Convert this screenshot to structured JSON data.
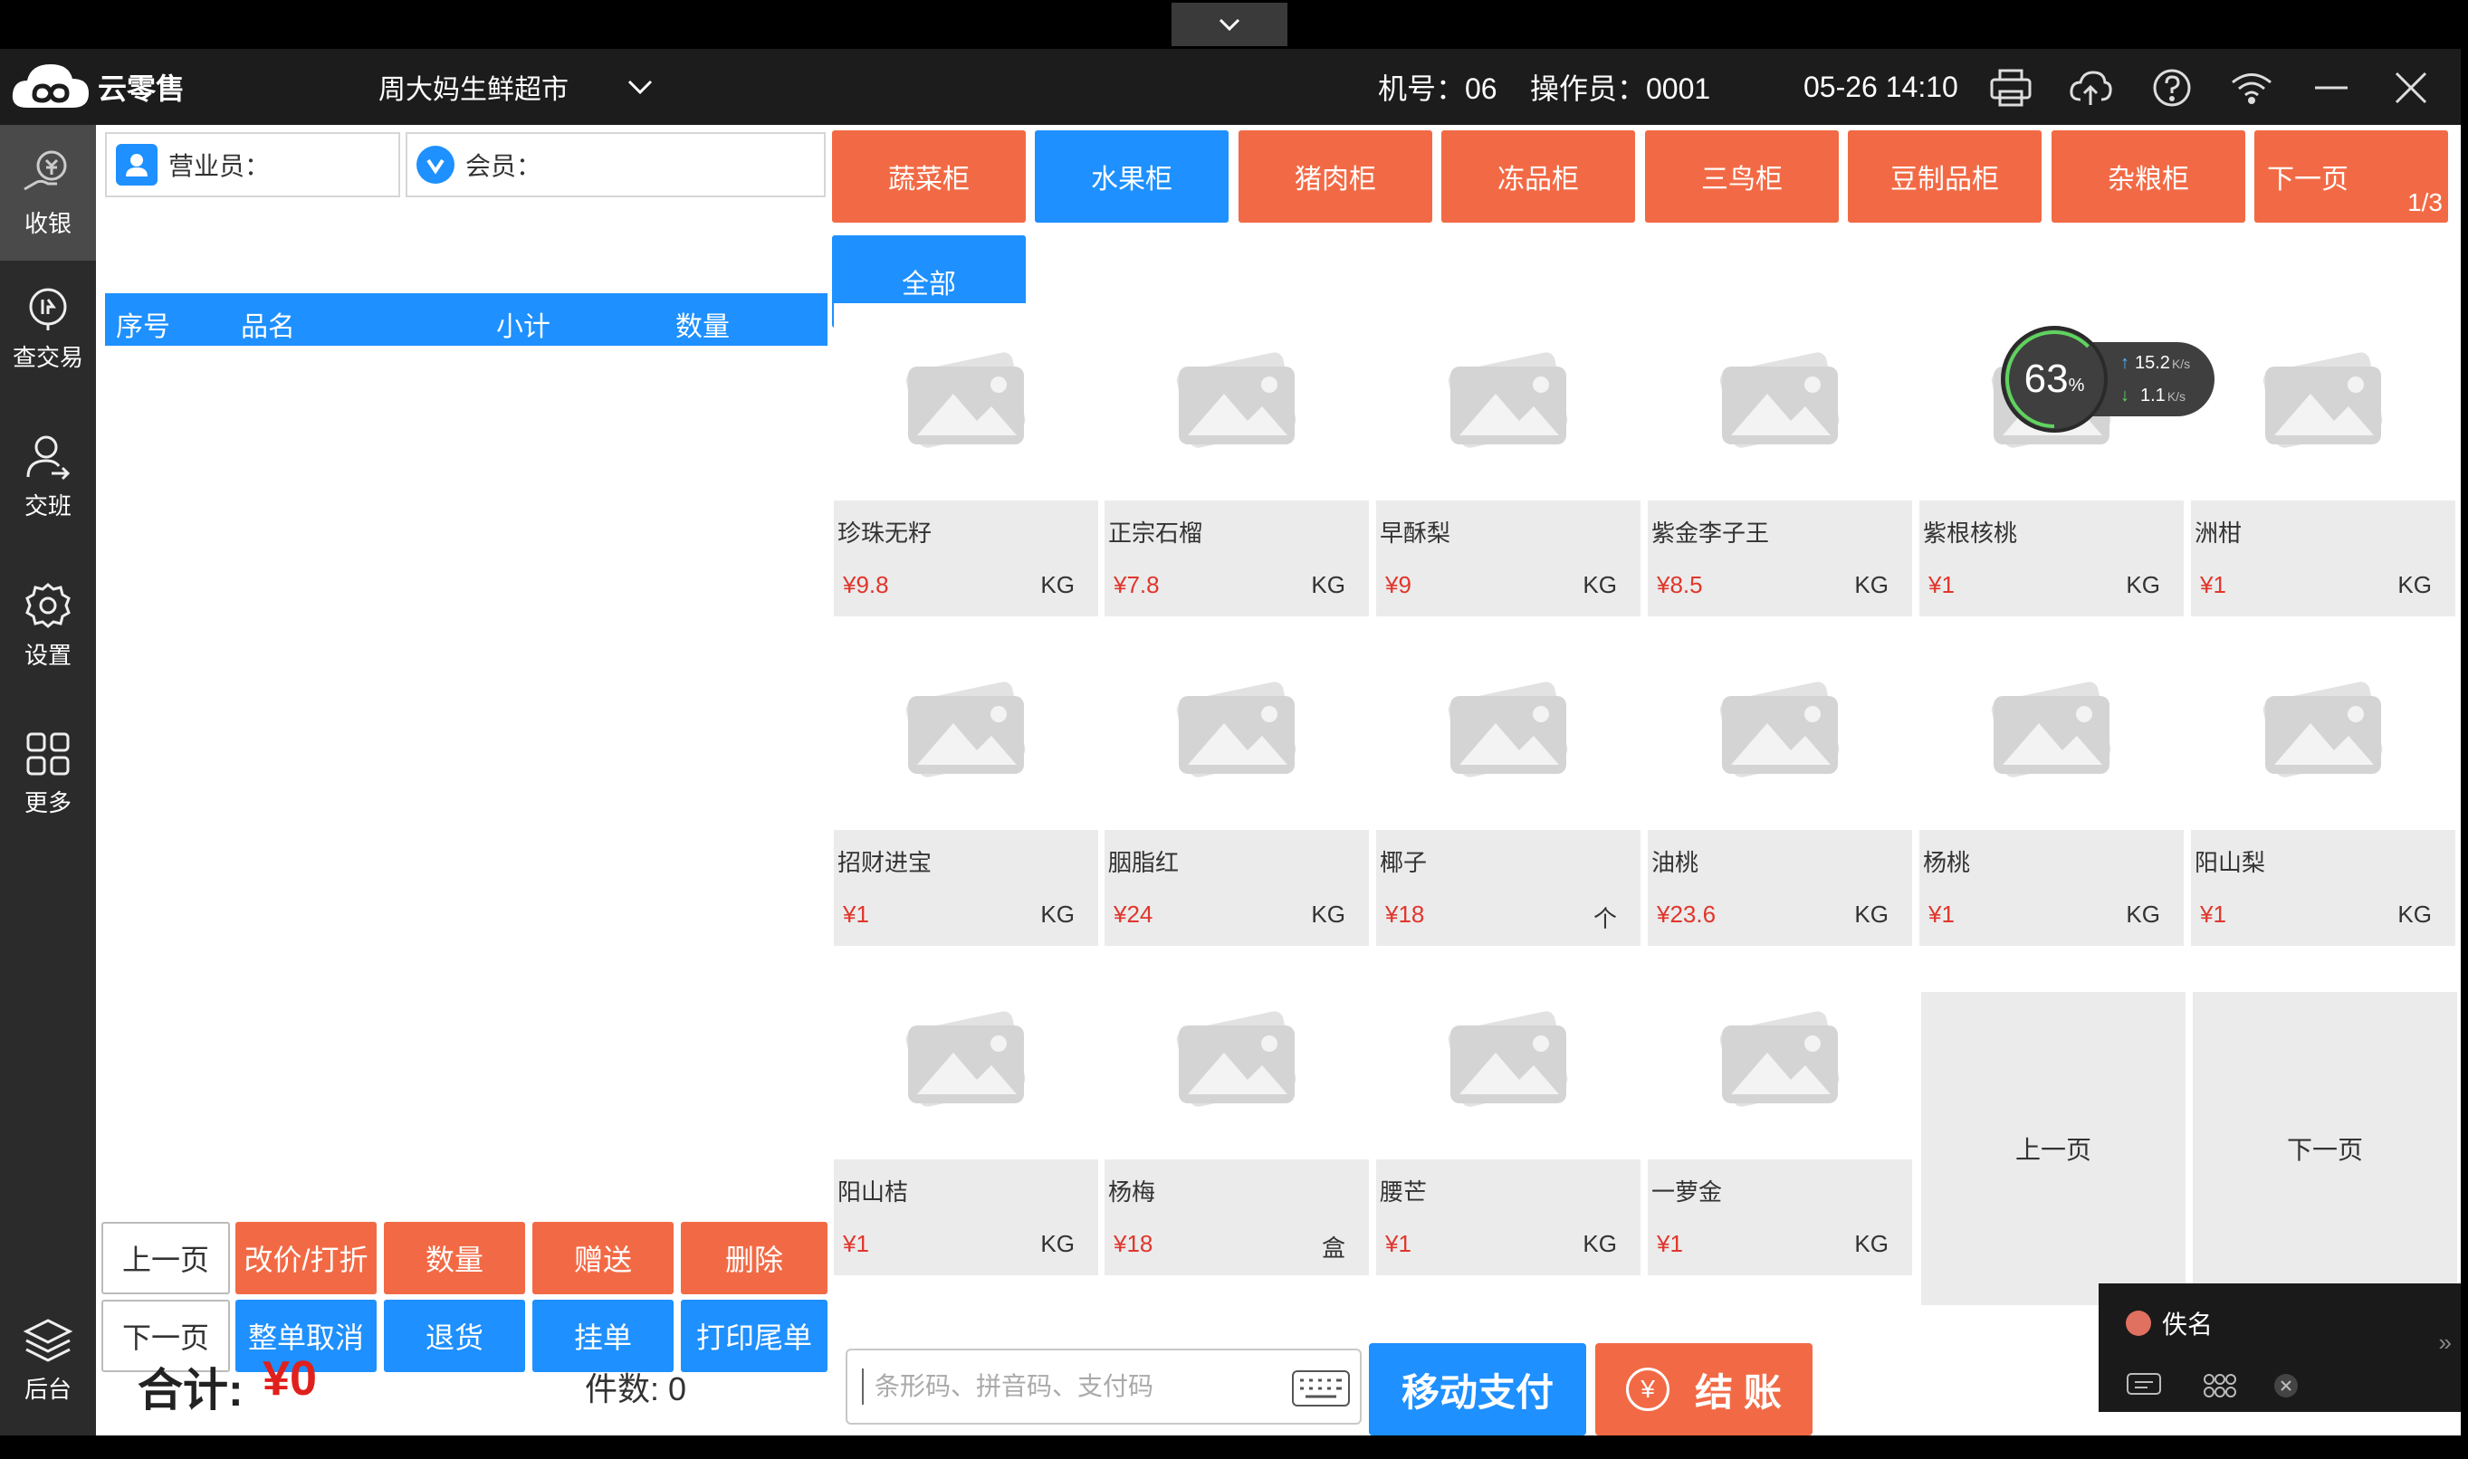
{
  "window": {
    "app_name": "云零售",
    "store_name": "周大妈生鲜超市",
    "machine_no": "机号：06",
    "operator": "操作员：0001",
    "datetime": "05-26 14:10"
  },
  "sidebar": {
    "items": [
      {
        "label": "收银",
        "icon": "cashier-icon"
      },
      {
        "label": "查交易",
        "icon": "transaction-query-icon"
      },
      {
        "label": "交班",
        "icon": "shift-handover-icon"
      },
      {
        "label": "设置",
        "icon": "settings-gear-icon"
      },
      {
        "label": "更多",
        "icon": "more-grid-icon"
      },
      {
        "label": "后台",
        "icon": "backend-layers-icon"
      }
    ]
  },
  "order": {
    "salesperson_label": "营业员：",
    "member_label": "会员：",
    "columns": [
      "序号",
      "品名",
      "小计",
      "数量"
    ],
    "buttons_row1": [
      "上一页",
      "改价/打折",
      "数量",
      "赠送",
      "删除"
    ],
    "buttons_row2": [
      "下一页",
      "整单取消",
      "退货",
      "挂单",
      "打印尾单"
    ],
    "total_label": "合计:",
    "total_value": "¥0",
    "qty_label": "件数: 0"
  },
  "categories": {
    "items": [
      "蔬菜柜",
      "水果柜",
      "猪肉柜",
      "冻品柜",
      "三鸟柜",
      "豆制品柜",
      "杂粮柜"
    ],
    "active_index": 1,
    "next_label": "下一页",
    "page_indicator": "1/3",
    "all_label": "全部"
  },
  "products": [
    {
      "name": "珍珠无籽",
      "price": "¥9.8",
      "unit": "KG"
    },
    {
      "name": "正宗石榴",
      "price": "¥7.8",
      "unit": "KG"
    },
    {
      "name": "早酥梨",
      "price": "¥9",
      "unit": "KG"
    },
    {
      "name": "紫金李子王",
      "price": "¥8.5",
      "unit": "KG"
    },
    {
      "name": "紫根核桃",
      "price": "¥1",
      "unit": "KG"
    },
    {
      "name": "洲柑",
      "price": "¥1",
      "unit": "KG"
    },
    {
      "name": "招财进宝",
      "price": "¥1",
      "unit": "KG"
    },
    {
      "name": "胭脂红",
      "price": "¥24",
      "unit": "KG"
    },
    {
      "name": "椰子",
      "price": "¥18",
      "unit": "个"
    },
    {
      "name": "油桃",
      "price": "¥23.6",
      "unit": "KG"
    },
    {
      "name": "杨桃",
      "price": "¥1",
      "unit": "KG"
    },
    {
      "name": "阳山梨",
      "price": "¥1",
      "unit": "KG"
    },
    {
      "name": "阳山桔",
      "price": "¥1",
      "unit": "KG"
    },
    {
      "name": "杨梅",
      "price": "¥18",
      "unit": "盒"
    },
    {
      "name": "腰芒",
      "price": "¥1",
      "unit": "KG"
    },
    {
      "name": "一萝金",
      "price": "¥1",
      "unit": "KG"
    }
  ],
  "product_pager": {
    "prev": "上一页",
    "next": "下一页"
  },
  "bottom": {
    "search_placeholder": "条形码、拼音码、支付码",
    "mobile_pay": "移动支付",
    "checkout": "结 账",
    "checkout_icon_text": "¥"
  },
  "net_widget": {
    "percent": "63",
    "percent_unit": "%",
    "up": "15.2",
    "down": "1.1",
    "speed_unit": "K/s"
  },
  "float_panel": {
    "user": "佚名"
  },
  "colors": {
    "accent_blue": "#1e90ff",
    "accent_orange": "#f26a45",
    "price_red": "#e0362c",
    "sidebar": "#2b2b2b",
    "titlebar": "#1c1c1c"
  }
}
